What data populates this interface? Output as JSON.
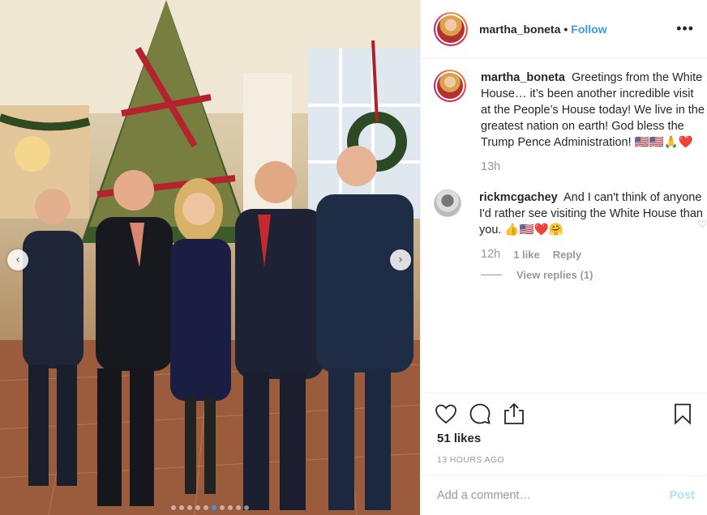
{
  "post": {
    "photo": {
      "prev_arrow": "‹",
      "next_arrow": "›",
      "dots_total": 10,
      "dots_active_index": 5
    },
    "header": {
      "username": "martha_boneta",
      "separator": "•",
      "follow_label": "Follow",
      "more_label": "•••"
    },
    "caption": {
      "username": "martha_boneta",
      "text": "Greetings from the White House… it’s been another incredible visit at the People’s House today! We live in the greatest nation on earth! God bless the Trump Pence Administration! 🇺🇸🇺🇸🙏❤️",
      "time": "13h"
    },
    "comments": [
      {
        "username": "rickmcgachey",
        "text": "And I can't think of anyone I'd rather see visiting the White House than you. 👍🇺🇸❤️🤗",
        "time": "12h",
        "likes_label": "1 like",
        "reply_label": "Reply",
        "view_replies_label": "View replies (1)",
        "like_icon": "♡"
      }
    ],
    "actions": {
      "like_icon": "heart-icon",
      "comment_icon": "comment-icon",
      "share_icon": "share-icon",
      "save_icon": "bookmark-icon"
    },
    "likes": "51 likes",
    "timestamp": "13 HOURS AGO",
    "add_comment": {
      "placeholder": "Add a comment…",
      "post_label": "Post"
    }
  }
}
